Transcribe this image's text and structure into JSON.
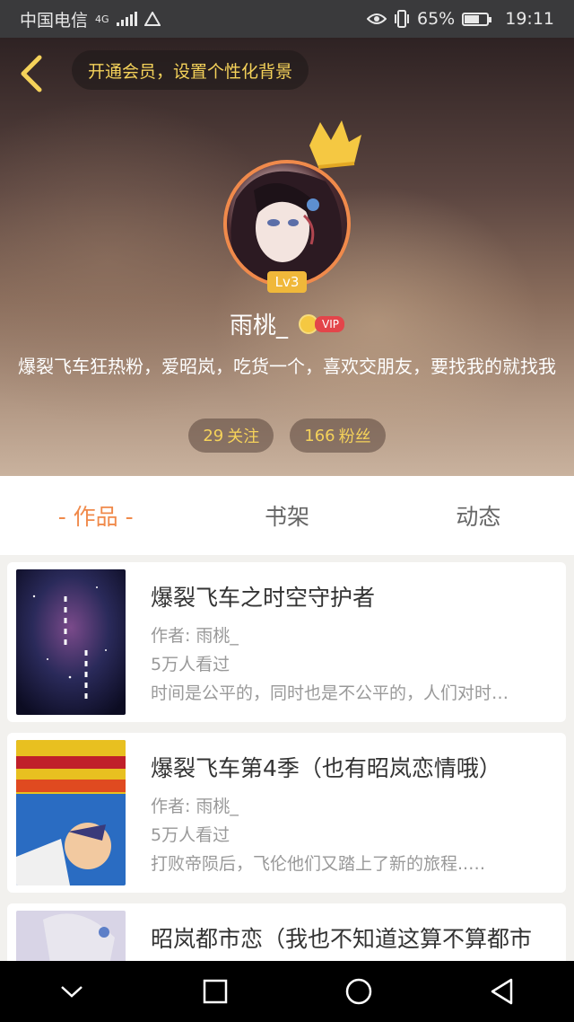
{
  "status_bar": {
    "carrier": "中国电信",
    "network": "4G",
    "battery": "65%",
    "battery_level": 0.65,
    "time": "19:11",
    "icons": [
      "eye-icon",
      "vibrate-icon",
      "battery-icon",
      "signal-icon",
      "warning-icon"
    ]
  },
  "header": {
    "vip_prompt": "开通会员，设置个性化背景",
    "level": "Lv3",
    "nickname": "雨桃_",
    "vip_tag": "VIP",
    "bio": "爆裂飞车狂热粉，爱昭岚，吃货一个，喜欢交朋友，要找我的就找我",
    "following_count": "29",
    "following_label": "关注",
    "followers_count": "166",
    "followers_label": "粉丝",
    "accent_color": "#f08a4b",
    "highlight_color": "#f5d25a"
  },
  "tabs": [
    {
      "label": "- 作品 -",
      "active": true
    },
    {
      "label": "书架",
      "active": false
    },
    {
      "label": "动态",
      "active": false
    }
  ],
  "works": [
    {
      "title": "爆裂飞车之时空守护者",
      "author_prefix": "作者:",
      "author": "雨桃_",
      "views": "5万人看过",
      "summary": "时间是公平的，同时也是不公平的，人们对时…"
    },
    {
      "title": "爆裂飞车第4季（也有昭岚恋情哦）",
      "author_prefix": "作者:",
      "author": "雨桃_",
      "views": "5万人看过",
      "summary": "打败帝陨后，飞伦他们又踏上了新的旅程..…"
    },
    {
      "title": "昭岚都市恋（我也不知道这算不算都市",
      "author_prefix": "",
      "author": "",
      "views": "",
      "summary": ""
    }
  ]
}
